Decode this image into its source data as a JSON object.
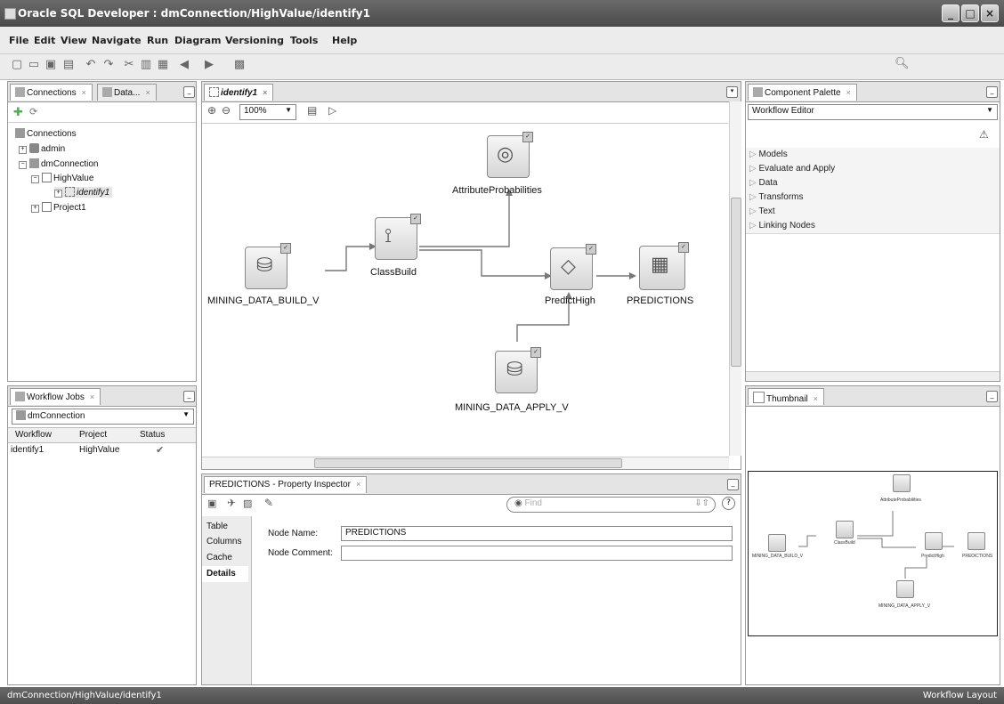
{
  "window": {
    "title": "Oracle SQL Developer : dmConnection/HighValue/identify1"
  },
  "menu": [
    "File",
    "Edit",
    "View",
    "Navigate",
    "Run",
    "Diagram",
    "Versioning",
    "Tools",
    "Help"
  ],
  "connections_panel": {
    "tabs": [
      "Connections",
      "Data..."
    ],
    "tree": {
      "root": "Connections",
      "admin": "admin",
      "dmConnection": "dmConnection",
      "highvalue": "HighValue",
      "identify1": "identify1",
      "project1": "Project1"
    }
  },
  "workflow_jobs": {
    "tab": "Workflow Jobs",
    "connection": "dmConnection",
    "headers": [
      "Workflow",
      "Project",
      "Status"
    ],
    "rows": [
      {
        "workflow": "identify1",
        "project": "HighValue",
        "status_icon": "check-icon"
      }
    ]
  },
  "editor": {
    "tab": "identify1",
    "zoom": "100%",
    "nodes": {
      "build": "MINING_DATA_BUILD_V",
      "classbuild": "ClassBuild",
      "attrprob": "AttributeProbabilities",
      "predict": "PredictHigh",
      "predictions": "PREDICTIONS",
      "apply": "MINING_DATA_APPLY_V"
    }
  },
  "palette": {
    "tab": "Component Palette",
    "selected": "Workflow Editor",
    "sections": [
      "Models",
      "Evaluate and Apply",
      "Data",
      "Transforms",
      "Text",
      "Linking Nodes"
    ]
  },
  "thumbnail": {
    "tab": "Thumbnail"
  },
  "inspector": {
    "tab": "PREDICTIONS - Property Inspector",
    "find_placeholder": "Find",
    "side_tabs": [
      "Table",
      "Columns",
      "Cache",
      "Details"
    ],
    "node_name_label": "Node Name:",
    "node_name_value": "PREDICTIONS",
    "node_comment_label": "Node Comment:",
    "node_comment_value": ""
  },
  "status": {
    "path": "dmConnection/HighValue/identify1",
    "right": "Workflow Layout"
  }
}
